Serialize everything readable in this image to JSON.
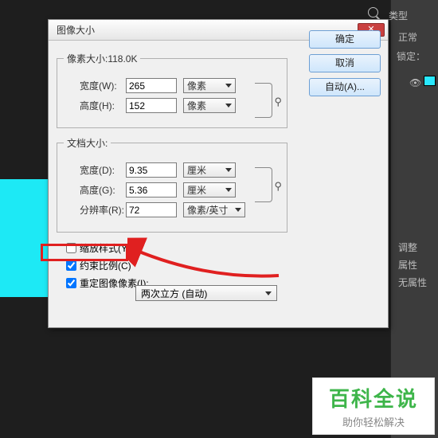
{
  "bg": {
    "type": "类型",
    "normal": "正常",
    "lock": "锁定：",
    "adjust": "调整",
    "attr": "属性",
    "noattr": "无属性"
  },
  "dialog": {
    "title": "图像大小",
    "ok": "确定",
    "cancel": "取消",
    "auto": "自动(A)..."
  },
  "pixel": {
    "legend": "像素大小:118.0K",
    "width_label": "宽度(W):",
    "width_value": "265",
    "width_unit": "像素",
    "height_label": "高度(H):",
    "height_value": "152",
    "height_unit": "像素"
  },
  "doc": {
    "legend": "文档大小:",
    "width_label": "宽度(D):",
    "width_value": "9.35",
    "width_unit": "厘米",
    "height_label": "高度(G):",
    "height_value": "5.36",
    "height_unit": "厘米",
    "res_label": "分辨率(R):",
    "res_value": "72",
    "res_unit": "像素/英寸"
  },
  "checks": {
    "scale": "缩放样式(Y)",
    "constrain": "约束比例(C)",
    "resample": "重定图像像素(I):"
  },
  "resample_method": "两次立方 (自动)",
  "watermark": {
    "big": "百科全说",
    "small": "助你轻松解决"
  }
}
